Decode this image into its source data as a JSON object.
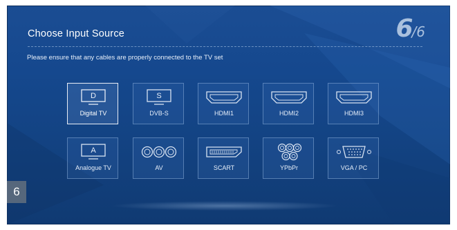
{
  "header": {
    "title": "Choose Input Source",
    "step_current": "6",
    "step_separator": "/",
    "step_total": "6"
  },
  "instruction": "Please ensure that any cables are properly connected to the TV set",
  "sources": [
    {
      "label": "Digital TV",
      "glyph": "D",
      "icon": "monitor-d-icon",
      "selected": true
    },
    {
      "label": "DVB-S",
      "glyph": "S",
      "icon": "monitor-s-icon",
      "selected": false
    },
    {
      "label": "HDMI1",
      "icon": "hdmi-port-icon",
      "selected": false
    },
    {
      "label": "HDMI2",
      "icon": "hdmi-port-icon",
      "selected": false
    },
    {
      "label": "HDMI3",
      "icon": "hdmi-port-icon",
      "selected": false
    },
    {
      "label": "Analogue TV",
      "glyph": "A",
      "icon": "monitor-a-icon",
      "selected": false
    },
    {
      "label": "AV",
      "icon": "av-connectors-icon",
      "selected": false
    },
    {
      "label": "SCART",
      "icon": "scart-port-icon",
      "selected": false
    },
    {
      "label": "YPbPr",
      "icon": "component-connectors-icon",
      "selected": false
    },
    {
      "label": "VGA / PC",
      "icon": "vga-port-icon",
      "selected": false
    }
  ],
  "page_badge": "6",
  "colors": {
    "background": "#15488e",
    "tile_border": "#a0bee4",
    "selected_border": "#e9eef6",
    "badge": "#56677c"
  }
}
